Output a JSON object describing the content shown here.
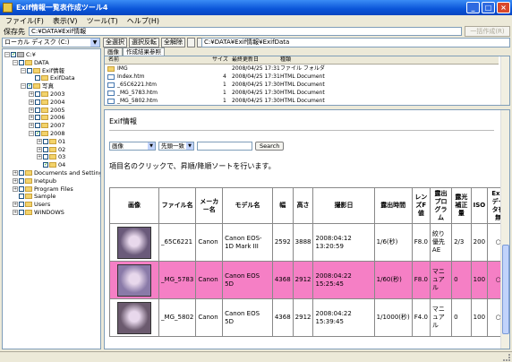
{
  "window": {
    "title": "Exif情報一覧表作成ツール4",
    "buttons": [
      "_",
      "□",
      "×"
    ]
  },
  "menu": [
    "ファイル(F)",
    "表示(V)",
    "ツール(T)",
    "ヘルプ(H)"
  ],
  "save": {
    "label": "保存先",
    "path": "C:¥DATA¥Exif情報",
    "start_button": "一括作成(R)"
  },
  "drive": {
    "value": "ローカル ディスク (C:)"
  },
  "toolbar": {
    "select_all": "全選択",
    "invert": "選択反転",
    "deselect": "全解除",
    "path": "C:¥DATA¥Exif情報¥ExifData"
  },
  "tree": [
    {
      "label": "C:¥",
      "level": 0,
      "exp": "−",
      "check": "✓",
      "icon": "drive"
    },
    {
      "label": "DATA",
      "level": 1,
      "exp": "−",
      "check": "",
      "icon": "folder"
    },
    {
      "label": "Exif情報",
      "level": 2,
      "exp": "−",
      "check": "",
      "icon": "folder"
    },
    {
      "label": "ExifData",
      "level": 3,
      "exp": "",
      "check": "",
      "icon": "folder"
    },
    {
      "label": "写真",
      "level": 2,
      "exp": "−",
      "check": "✓",
      "icon": "folder"
    },
    {
      "label": "2003",
      "level": 3,
      "exp": "+",
      "check": "",
      "icon": "folder"
    },
    {
      "label": "2004",
      "level": 3,
      "exp": "+",
      "check": "",
      "icon": "folder"
    },
    {
      "label": "2005",
      "level": 3,
      "exp": "+",
      "check": "",
      "icon": "folder"
    },
    {
      "label": "2006",
      "level": 3,
      "exp": "+",
      "check": "",
      "icon": "folder"
    },
    {
      "label": "2007",
      "level": 3,
      "exp": "+",
      "check": "",
      "icon": "folder"
    },
    {
      "label": "2008",
      "level": 3,
      "exp": "−",
      "check": "✓",
      "icon": "folder"
    },
    {
      "label": "01",
      "level": 4,
      "exp": "+",
      "check": "",
      "icon": "folder"
    },
    {
      "label": "02",
      "level": 4,
      "exp": "+",
      "check": "",
      "icon": "folder"
    },
    {
      "label": "03",
      "level": 4,
      "exp": "+",
      "check": "",
      "icon": "folder"
    },
    {
      "label": "04",
      "level": 4,
      "exp": "",
      "check": "✓",
      "icon": "folder"
    },
    {
      "label": "Documents and Settings",
      "level": 1,
      "exp": "+",
      "check": "",
      "icon": "folder"
    },
    {
      "label": "Inetpub",
      "level": 1,
      "exp": "+",
      "check": "",
      "icon": "folder"
    },
    {
      "label": "Program Files",
      "level": 1,
      "exp": "+",
      "check": "",
      "icon": "folder"
    },
    {
      "label": "Sample",
      "level": 1,
      "exp": "",
      "check": "",
      "icon": "folder"
    },
    {
      "label": "Users",
      "level": 1,
      "exp": "+",
      "check": "",
      "icon": "folder"
    },
    {
      "label": "WINDOWS",
      "level": 1,
      "exp": "+",
      "check": "",
      "icon": "folder"
    }
  ],
  "tabs": [
    "画像",
    "作成結果参照"
  ],
  "filelist": {
    "headers": [
      "名前",
      "サイズ",
      "最終更新日",
      "種類"
    ],
    "rows": [
      {
        "name": "IMG",
        "size": "",
        "date": "2008/04/25 17:31",
        "type": "ファイル フォルダ",
        "kind": "folder"
      },
      {
        "name": "Index.htm",
        "size": "4",
        "date": "2008/04/25 17:31",
        "type": "HTML Document",
        "kind": "doc"
      },
      {
        "name": "_65C6221.htm",
        "size": "1",
        "date": "2008/04/25 17:30",
        "type": "HTML Document",
        "kind": "doc"
      },
      {
        "name": "_MG_5783.htm",
        "size": "1",
        "date": "2008/04/25 17:30",
        "type": "HTML Document",
        "kind": "doc"
      },
      {
        "name": "_MG_5802.htm",
        "size": "1",
        "date": "2008/04/25 17:30",
        "type": "HTML Document",
        "kind": "doc"
      }
    ]
  },
  "browser": {
    "heading": "Exif情報",
    "select1": "画像",
    "select2": "先頭一致",
    "search_button": "Search",
    "hint": "項目名のクリックで、昇順/降順ソートを行います。",
    "columns": [
      "画像",
      "ファイル名",
      "メーカー名",
      "モデル名",
      "幅",
      "高さ",
      "撮影日",
      "露出時間",
      "レンズF値",
      "露出プログラム",
      "露光補正量",
      "ISO",
      "Exifデータ有無"
    ],
    "rows": [
      {
        "thumb_color": "#6a5a7a",
        "cells": [
          "_65C6221",
          "Canon",
          "Canon EOS-1D Mark III",
          "2592",
          "3888",
          "2008:04:12 13:20:59",
          "1/6(秒)",
          "F8.0",
          "絞り優先AE",
          "2/3",
          "200",
          "○"
        ],
        "highlight": false
      },
      {
        "thumb_color": "#8a7aa8",
        "cells": [
          "_MG_5783",
          "Canon",
          "Canon EOS 5D",
          "4368",
          "2912",
          "2008:04:22 15:25:45",
          "1/60(秒)",
          "F8.0",
          "マニュアル",
          "0",
          "100",
          "○"
        ],
        "highlight": true
      },
      {
        "thumb_color": "#6b5a6e",
        "cells": [
          "_MG_5802",
          "Canon",
          "Canon EOS 5D",
          "4368",
          "2912",
          "2008:04:22 15:39:45",
          "1/1000(秒)",
          "F4.0",
          "マニュアル",
          "0",
          "100",
          "○"
        ],
        "highlight": false
      }
    ]
  }
}
